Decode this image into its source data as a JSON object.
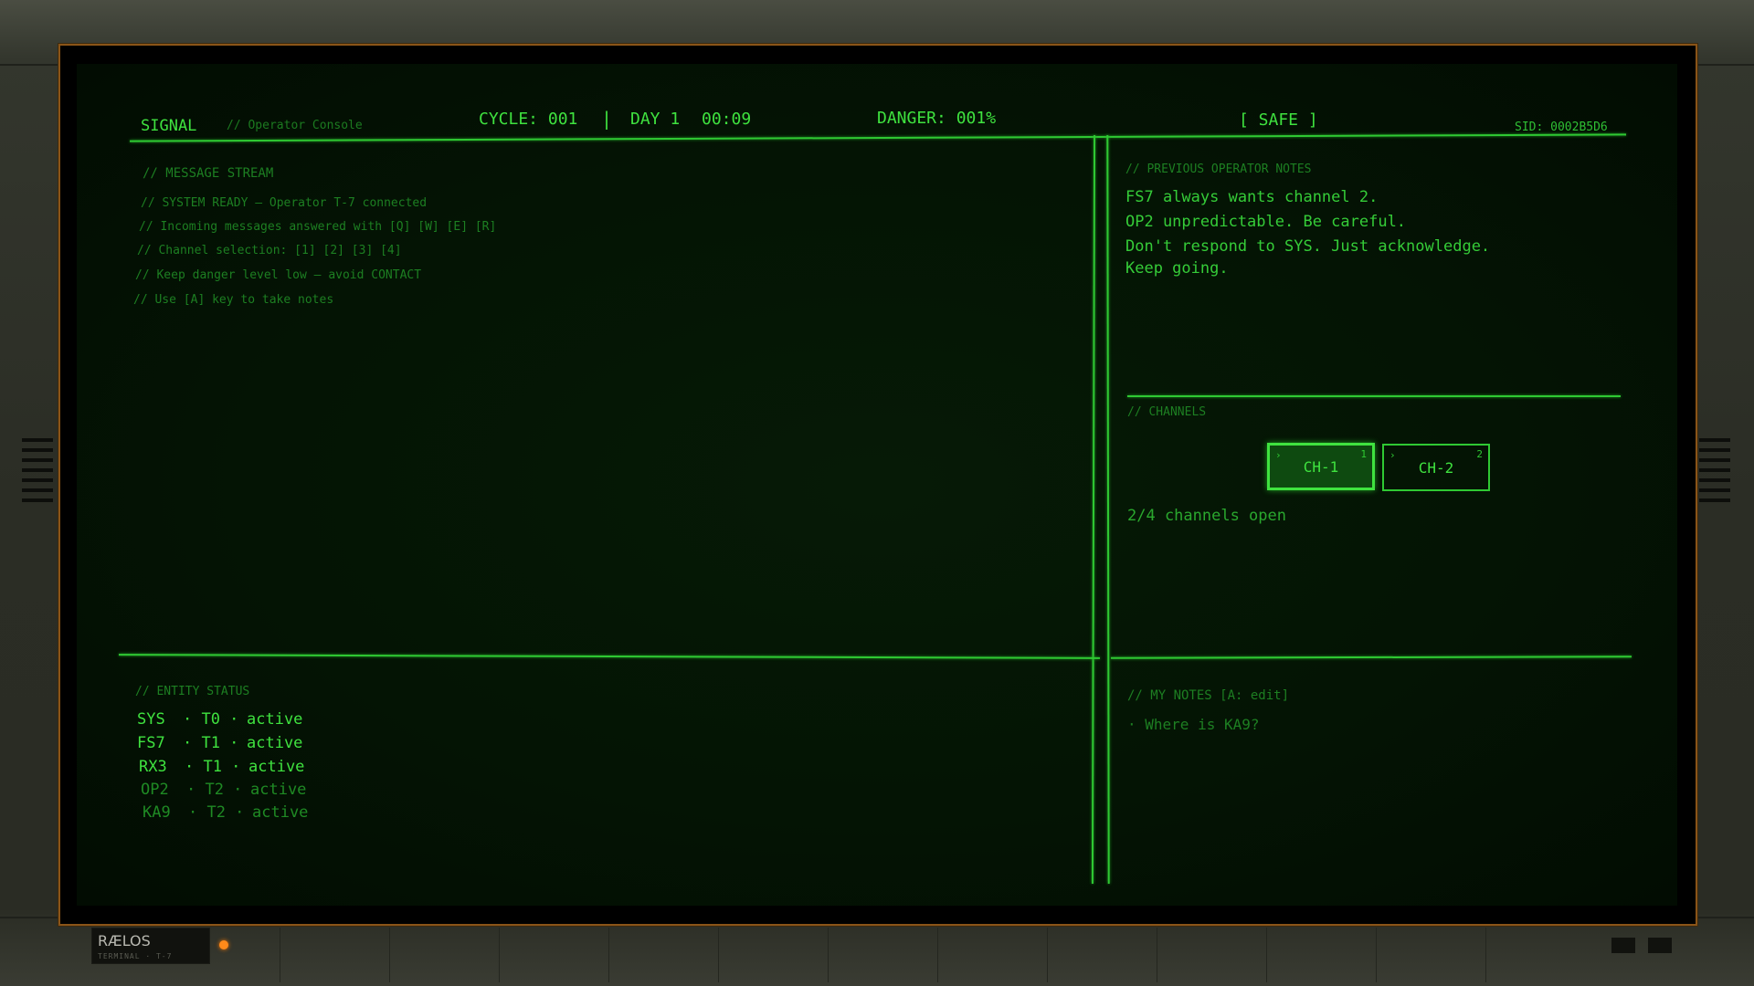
{
  "header": {
    "title": "SIGNAL",
    "subtitle": "// Operator Console",
    "cycle": "CYCLE: 001",
    "separator": "|",
    "day": "DAY 1",
    "time": "00:09",
    "danger": "DANGER: 001%",
    "status": "[ SAFE ]",
    "sid": "SID: 0002B5D6"
  },
  "message_stream": {
    "heading": "// MESSAGE STREAM",
    "lines": [
      "// SYSTEM READY — Operator T-7 connected",
      "// Incoming messages answered with [Q] [W] [E] [R]",
      "// Channel selection: [1] [2] [3] [4]",
      "// Keep danger level low — avoid CONTACT",
      "// Use [A] key to take notes"
    ]
  },
  "previous_notes": {
    "heading": "// PREVIOUS OPERATOR NOTES",
    "lines": [
      "FS7 always wants channel 2.",
      "OP2 unpredictable. Be careful.",
      "Don't respond to SYS. Just acknowledge.",
      "Keep going."
    ]
  },
  "channels": {
    "heading": "// CHANNELS",
    "buttons": [
      {
        "label": "CH-1",
        "chevron": "›",
        "number": "1",
        "active": true
      },
      {
        "label": "CH-2",
        "chevron": "›",
        "number": "2",
        "active": false
      }
    ],
    "open_text": "2/4 channels open"
  },
  "entity_status": {
    "heading": "// ENTITY STATUS",
    "rows": [
      {
        "id": "SYS",
        "tier": "· T0 ·",
        "state": "active"
      },
      {
        "id": "FS7",
        "tier": "· T1 ·",
        "state": "active"
      },
      {
        "id": "RX3",
        "tier": "· T1 ·",
        "state": "active"
      },
      {
        "id": "OP2",
        "tier": "· T2 ·",
        "state": "active"
      },
      {
        "id": "KA9",
        "tier": "· T2 ·",
        "state": "active"
      }
    ]
  },
  "my_notes": {
    "heading": "// MY NOTES  [A: edit]",
    "lines": [
      "· Where is KA9?"
    ]
  },
  "footer": {
    "brand": "RÆLOS",
    "brand_sub": "TERMINAL · T-7"
  },
  "colors": {
    "phosphor": "#3fe23f",
    "phosphor_dim": "#1d7f22",
    "bezel_trim": "#8a5418",
    "led": "#ff8a1a"
  }
}
